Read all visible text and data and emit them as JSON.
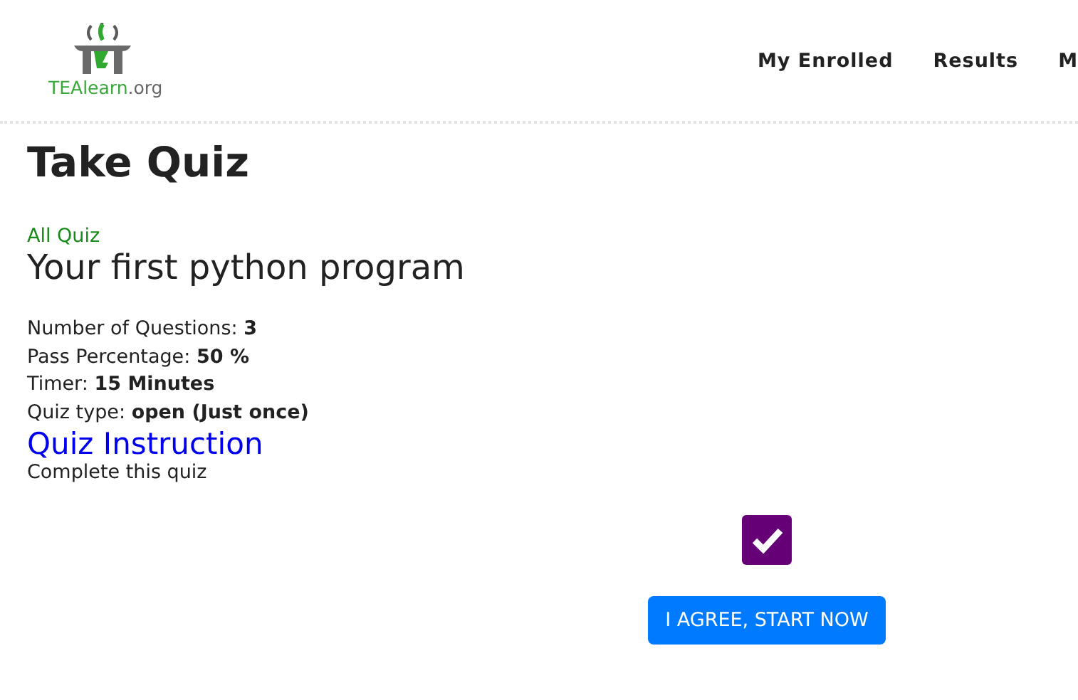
{
  "header": {
    "logo": {
      "name": "TEAlearn",
      "suffix": ".org"
    },
    "nav": [
      "My Enrolled",
      "Results",
      "M"
    ]
  },
  "page_title": "Take Quiz",
  "breadcrumb": "All Quiz",
  "quiz_title": "Your first python program",
  "details": [
    "Number of Questions: **3**",
    "Pass Percentage: **50 %**",
    "Timer: **15 Minutes**",
    "Quiz type: **open (Just once)**"
  ],
  "instruction_heading": "Quiz Instruction",
  "instruction": "Complete this quiz",
  "agree": {
    "checked": true
  },
  "start_button": "I AGREE, START NOW"
}
